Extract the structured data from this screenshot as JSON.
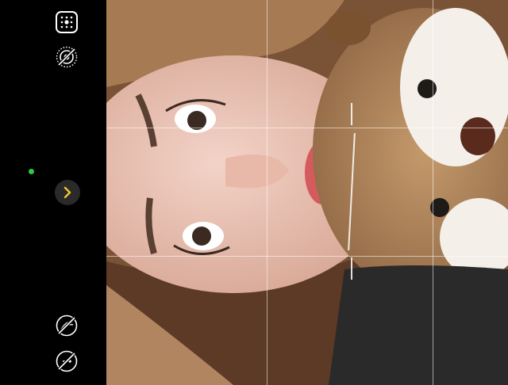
{
  "camera": {
    "controls": {
      "top": [
        {
          "name": "grid-toggle-icon",
          "interactable": true
        },
        {
          "name": "live-photo-off-icon",
          "interactable": true
        }
      ],
      "bottom": [
        {
          "name": "filters-off-icon",
          "interactable": true
        },
        {
          "name": "exposure-off-icon",
          "interactable": true
        }
      ],
      "expand_icon": "chevron-right-icon"
    },
    "indicator": {
      "status": "camera-in-use",
      "color": "#2ecc40"
    },
    "accent_color": "#f4c430",
    "grid": {
      "visible": true,
      "rows": 3,
      "cols": 3
    }
  }
}
